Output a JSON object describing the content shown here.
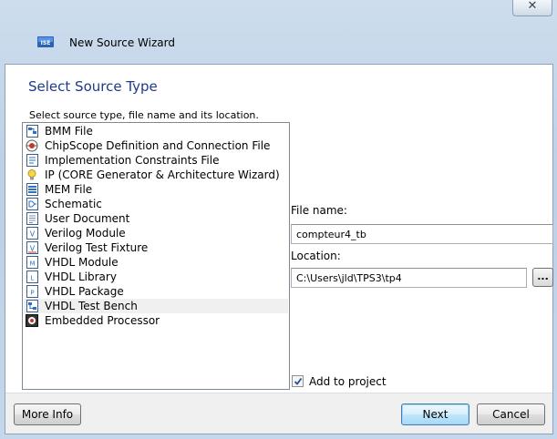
{
  "window": {
    "title": "New Source Wizard",
    "close_glyph": "✕"
  },
  "page": {
    "heading": "Select Source Type",
    "instruction": "Select source type, file name and its location."
  },
  "source_types": [
    {
      "label": "BMM File",
      "icon": "bmm-file-icon"
    },
    {
      "label": "ChipScope Definition and Connection File",
      "icon": "chipscope-icon"
    },
    {
      "label": "Implementation Constraints File",
      "icon": "constraints-file-icon"
    },
    {
      "label": "IP (CORE Generator & Architecture Wizard)",
      "icon": "ip-core-icon"
    },
    {
      "label": "MEM File",
      "icon": "mem-file-icon"
    },
    {
      "label": "Schematic",
      "icon": "schematic-icon"
    },
    {
      "label": "User Document",
      "icon": "user-document-icon"
    },
    {
      "label": "Verilog Module",
      "icon": "verilog-module-icon"
    },
    {
      "label": "Verilog Test Fixture",
      "icon": "verilog-test-fixture-icon"
    },
    {
      "label": "VHDL Module",
      "icon": "vhdl-module-icon"
    },
    {
      "label": "VHDL Library",
      "icon": "vhdl-library-icon"
    },
    {
      "label": "VHDL Package",
      "icon": "vhdl-package-icon"
    },
    {
      "label": "VHDL Test Bench",
      "icon": "vhdl-test-bench-icon",
      "selected": true
    },
    {
      "label": "Embedded Processor",
      "icon": "embedded-processor-icon"
    }
  ],
  "form": {
    "file_name_label": "File name:",
    "file_name_value": "compteur4_tb",
    "location_label": "Location:",
    "location_value": "C:\\Users\\jld\\TPS3\\tp4",
    "browse_label": "...",
    "add_to_project_label": "Add to project",
    "add_to_project_checked": true
  },
  "buttons": {
    "more_info": "More Info",
    "next": "Next",
    "cancel": "Cancel"
  },
  "colors": {
    "heading": "#1e3a8a",
    "selected_row": "#f0f0f0",
    "default_button_border": "#3c7fb1"
  }
}
